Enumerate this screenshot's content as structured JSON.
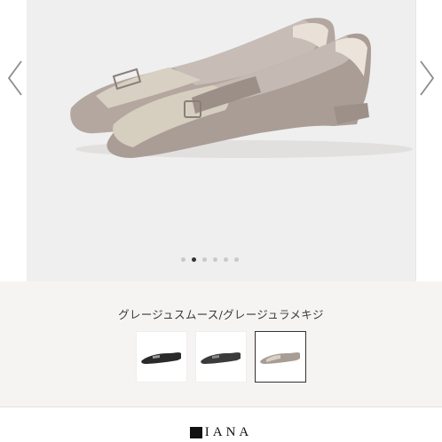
{
  "carousel": {
    "prev_icon": "chevron-left-icon",
    "next_icon": "chevron-right-icon",
    "slide_count": 6,
    "active_index": 1,
    "image": "gray-beige pointed-toe flat shoe with glitter vamp and buckle strap"
  },
  "product": {
    "color_name": "グレージュスムース/グレージュラメキジ",
    "swatches": [
      {
        "color": "#2a2a2a",
        "selected": false
      },
      {
        "color": "#3b3b3b",
        "selected": false
      },
      {
        "color": "#a89d95",
        "selected": true
      }
    ]
  },
  "footer": {
    "brand": "IANA",
    "accent": "#111111"
  }
}
